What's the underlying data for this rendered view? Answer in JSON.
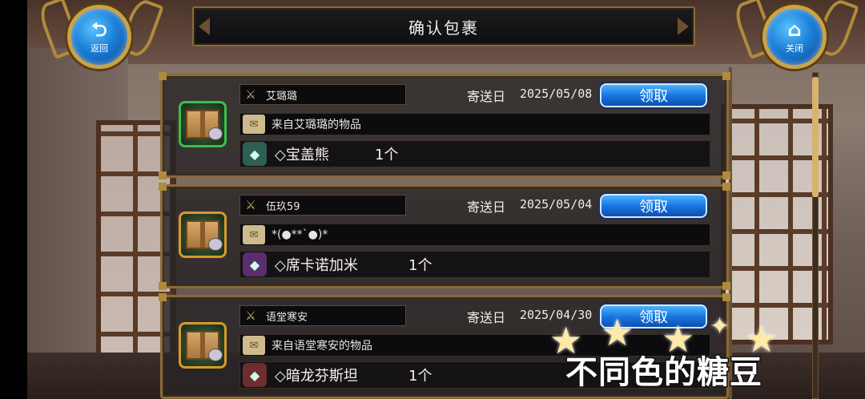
{
  "header": {
    "title": "确认包裹",
    "back_label": "返回",
    "close_label": "关闭"
  },
  "mails": [
    {
      "sender": "艾璐璐",
      "date_label": "寄送日",
      "date": "2025/05/08",
      "claim_label": "领取",
      "message": "来自艾璐璐的物品",
      "item_name": "◇宝盖熊",
      "item_qty": "1个",
      "gem_color": "#2f5e52"
    },
    {
      "sender": "伍玖59",
      "date_label": "寄送日",
      "date": "2025/05/04",
      "claim_label": "领取",
      "message": "*(●**`●)*",
      "item_name": "◇席卡诺加米",
      "item_qty": "1个",
      "gem_color": "#5a2e6e"
    },
    {
      "sender": "语堂寒安",
      "date_label": "寄送日",
      "date": "2025/04/30",
      "claim_label": "领取",
      "message": "来自语堂寒安的物品",
      "item_name": "◇暗龙芬斯坦",
      "item_qty": "1个",
      "gem_color": "#6e2e2e"
    }
  ],
  "overlay": {
    "caption": "不同色的糖豆"
  },
  "colors": {
    "accent_gold": "#8a6a3a",
    "claim_blue": "#1877e0",
    "package_green": "#38c04a"
  }
}
